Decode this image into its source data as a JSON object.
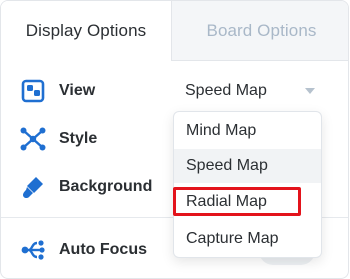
{
  "tabs": {
    "display": "Display Options",
    "board": "Board Options"
  },
  "rows": {
    "view": "View",
    "style": "Style",
    "background": "Background",
    "auto_focus": "Auto Focus"
  },
  "view_select": {
    "value": "Speed Map"
  },
  "dropdown": {
    "options": [
      "Mind Map",
      "Speed Map",
      "Radial Map",
      "Capture Map"
    ],
    "highlighted": "Speed Map",
    "outlined": "Radial Map"
  },
  "icons": {
    "view": "view-layout-icon",
    "style": "style-nodes-icon",
    "background": "paint-brush-icon",
    "auto_focus": "auto-focus-icon",
    "select_caret": "chevron-down-icon"
  },
  "colors": {
    "accent": "#1f6fd1",
    "tab_inactive_text": "#a9b8c8",
    "outline_red": "#e3131b"
  }
}
